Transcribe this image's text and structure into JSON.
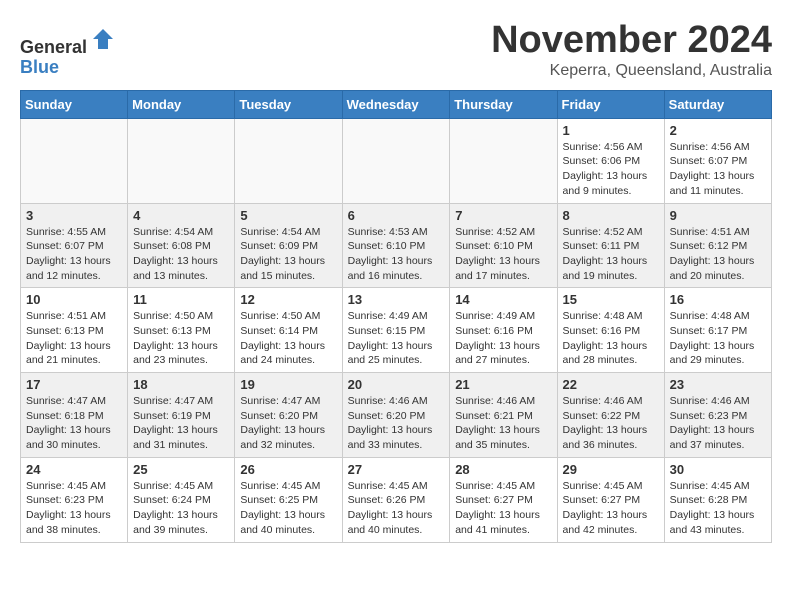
{
  "header": {
    "logo_line1": "General",
    "logo_line2": "Blue",
    "month_title": "November 2024",
    "location": "Keperra, Queensland, Australia"
  },
  "weekdays": [
    "Sunday",
    "Monday",
    "Tuesday",
    "Wednesday",
    "Thursday",
    "Friday",
    "Saturday"
  ],
  "weeks": [
    [
      {
        "day": "",
        "info": ""
      },
      {
        "day": "",
        "info": ""
      },
      {
        "day": "",
        "info": ""
      },
      {
        "day": "",
        "info": ""
      },
      {
        "day": "",
        "info": ""
      },
      {
        "day": "1",
        "info": "Sunrise: 4:56 AM\nSunset: 6:06 PM\nDaylight: 13 hours and 9 minutes."
      },
      {
        "day": "2",
        "info": "Sunrise: 4:56 AM\nSunset: 6:07 PM\nDaylight: 13 hours and 11 minutes."
      }
    ],
    [
      {
        "day": "3",
        "info": "Sunrise: 4:55 AM\nSunset: 6:07 PM\nDaylight: 13 hours and 12 minutes."
      },
      {
        "day": "4",
        "info": "Sunrise: 4:54 AM\nSunset: 6:08 PM\nDaylight: 13 hours and 13 minutes."
      },
      {
        "day": "5",
        "info": "Sunrise: 4:54 AM\nSunset: 6:09 PM\nDaylight: 13 hours and 15 minutes."
      },
      {
        "day": "6",
        "info": "Sunrise: 4:53 AM\nSunset: 6:10 PM\nDaylight: 13 hours and 16 minutes."
      },
      {
        "day": "7",
        "info": "Sunrise: 4:52 AM\nSunset: 6:10 PM\nDaylight: 13 hours and 17 minutes."
      },
      {
        "day": "8",
        "info": "Sunrise: 4:52 AM\nSunset: 6:11 PM\nDaylight: 13 hours and 19 minutes."
      },
      {
        "day": "9",
        "info": "Sunrise: 4:51 AM\nSunset: 6:12 PM\nDaylight: 13 hours and 20 minutes."
      }
    ],
    [
      {
        "day": "10",
        "info": "Sunrise: 4:51 AM\nSunset: 6:13 PM\nDaylight: 13 hours and 21 minutes."
      },
      {
        "day": "11",
        "info": "Sunrise: 4:50 AM\nSunset: 6:13 PM\nDaylight: 13 hours and 23 minutes."
      },
      {
        "day": "12",
        "info": "Sunrise: 4:50 AM\nSunset: 6:14 PM\nDaylight: 13 hours and 24 minutes."
      },
      {
        "day": "13",
        "info": "Sunrise: 4:49 AM\nSunset: 6:15 PM\nDaylight: 13 hours and 25 minutes."
      },
      {
        "day": "14",
        "info": "Sunrise: 4:49 AM\nSunset: 6:16 PM\nDaylight: 13 hours and 27 minutes."
      },
      {
        "day": "15",
        "info": "Sunrise: 4:48 AM\nSunset: 6:16 PM\nDaylight: 13 hours and 28 minutes."
      },
      {
        "day": "16",
        "info": "Sunrise: 4:48 AM\nSunset: 6:17 PM\nDaylight: 13 hours and 29 minutes."
      }
    ],
    [
      {
        "day": "17",
        "info": "Sunrise: 4:47 AM\nSunset: 6:18 PM\nDaylight: 13 hours and 30 minutes."
      },
      {
        "day": "18",
        "info": "Sunrise: 4:47 AM\nSunset: 6:19 PM\nDaylight: 13 hours and 31 minutes."
      },
      {
        "day": "19",
        "info": "Sunrise: 4:47 AM\nSunset: 6:20 PM\nDaylight: 13 hours and 32 minutes."
      },
      {
        "day": "20",
        "info": "Sunrise: 4:46 AM\nSunset: 6:20 PM\nDaylight: 13 hours and 33 minutes."
      },
      {
        "day": "21",
        "info": "Sunrise: 4:46 AM\nSunset: 6:21 PM\nDaylight: 13 hours and 35 minutes."
      },
      {
        "day": "22",
        "info": "Sunrise: 4:46 AM\nSunset: 6:22 PM\nDaylight: 13 hours and 36 minutes."
      },
      {
        "day": "23",
        "info": "Sunrise: 4:46 AM\nSunset: 6:23 PM\nDaylight: 13 hours and 37 minutes."
      }
    ],
    [
      {
        "day": "24",
        "info": "Sunrise: 4:45 AM\nSunset: 6:23 PM\nDaylight: 13 hours and 38 minutes."
      },
      {
        "day": "25",
        "info": "Sunrise: 4:45 AM\nSunset: 6:24 PM\nDaylight: 13 hours and 39 minutes."
      },
      {
        "day": "26",
        "info": "Sunrise: 4:45 AM\nSunset: 6:25 PM\nDaylight: 13 hours and 40 minutes."
      },
      {
        "day": "27",
        "info": "Sunrise: 4:45 AM\nSunset: 6:26 PM\nDaylight: 13 hours and 40 minutes."
      },
      {
        "day": "28",
        "info": "Sunrise: 4:45 AM\nSunset: 6:27 PM\nDaylight: 13 hours and 41 minutes."
      },
      {
        "day": "29",
        "info": "Sunrise: 4:45 AM\nSunset: 6:27 PM\nDaylight: 13 hours and 42 minutes."
      },
      {
        "day": "30",
        "info": "Sunrise: 4:45 AM\nSunset: 6:28 PM\nDaylight: 13 hours and 43 minutes."
      }
    ]
  ]
}
